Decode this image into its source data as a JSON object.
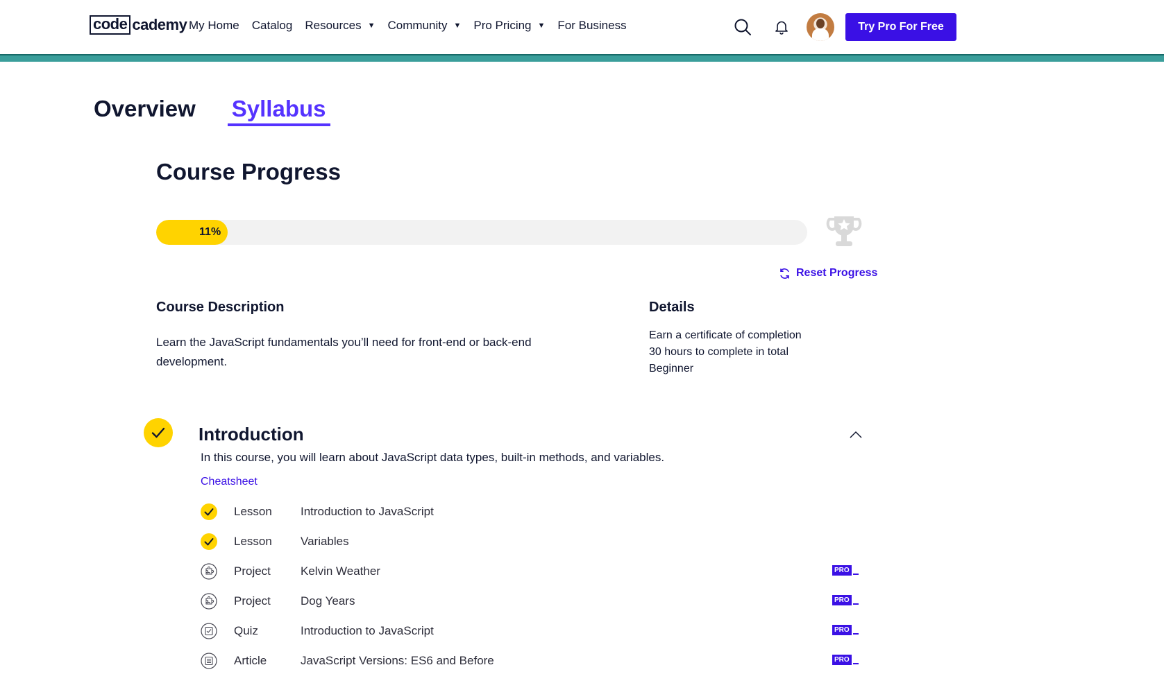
{
  "nav": {
    "logo_box": "code",
    "logo_rest": "cademy",
    "links": [
      {
        "label": "My Home"
      },
      {
        "label": "Catalog"
      },
      {
        "label": "Resources"
      },
      {
        "label": "Community"
      },
      {
        "label": "Pro Pricing"
      },
      {
        "label": "For Business"
      }
    ],
    "cta_label": "Try Pro For Free"
  },
  "tabs": [
    {
      "label": "Overview",
      "active": false
    },
    {
      "label": "Syllabus",
      "active": true
    }
  ],
  "progress": {
    "heading": "Course Progress",
    "percent": 11,
    "percent_label": "11%",
    "reset_label": "Reset Progress"
  },
  "description": {
    "heading": "Course Description",
    "text": "Learn the JavaScript fundamentals you’ll need for front-end or back-end development."
  },
  "details": {
    "heading": "Details",
    "items": [
      "Earn a certificate of completion",
      "30 hours to complete in total",
      "Beginner"
    ]
  },
  "module": {
    "title": "Introduction",
    "description": "In this course, you will learn about JavaScript data types, built-in methods, and variables.",
    "cheatsheet_label": "Cheatsheet",
    "items": [
      {
        "type": "Lesson",
        "name": "Introduction to JavaScript",
        "status": "completed",
        "icon": "check-icon",
        "pro": false
      },
      {
        "type": "Lesson",
        "name": "Variables",
        "status": "completed",
        "icon": "check-icon",
        "pro": false
      },
      {
        "type": "Project",
        "name": "Kelvin Weather",
        "status": "not-started",
        "icon": "puzzle-icon",
        "pro": true,
        "pro_label": "PRO"
      },
      {
        "type": "Project",
        "name": "Dog Years",
        "status": "not-started",
        "icon": "puzzle-icon",
        "pro": true,
        "pro_label": "PRO"
      },
      {
        "type": "Quiz",
        "name": "Introduction to JavaScript",
        "status": "not-started",
        "icon": "quiz-icon",
        "pro": true,
        "pro_label": "PRO"
      },
      {
        "type": "Article",
        "name": "JavaScript Versions: ES6 and Before",
        "status": "not-started",
        "icon": "article-icon",
        "pro": true,
        "pro_label": "PRO"
      }
    ]
  },
  "colors": {
    "accent": "#3a10e5",
    "tab_active": "#5533ff",
    "progress_fill": "#ffd300",
    "stripe": "#3a9e9b"
  }
}
